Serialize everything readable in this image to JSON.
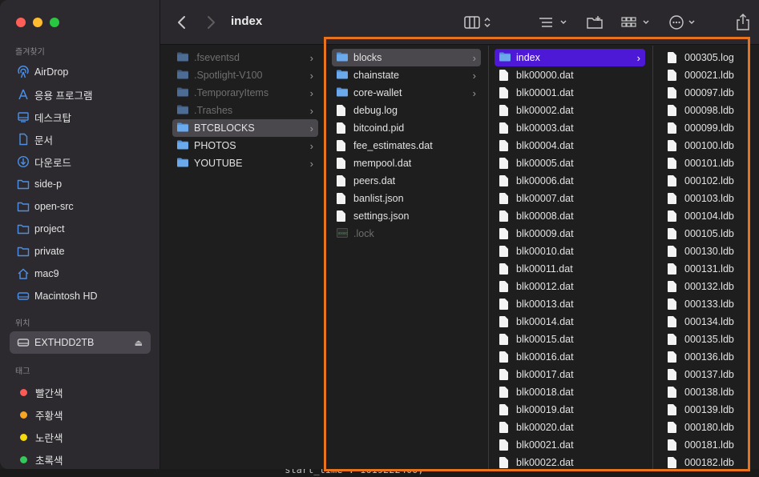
{
  "window": {
    "title": "index"
  },
  "sidebar": {
    "favorites_heading": "즐겨찾기",
    "favorites": [
      {
        "label": "AirDrop",
        "icon": "airdrop-icon"
      },
      {
        "label": "응용 프로그램",
        "icon": "applications-icon"
      },
      {
        "label": "데스크탑",
        "icon": "desktop-icon"
      },
      {
        "label": "문서",
        "icon": "document-icon"
      },
      {
        "label": "다운로드",
        "icon": "download-icon"
      },
      {
        "label": "side-p",
        "icon": "folder-icon"
      },
      {
        "label": "open-src",
        "icon": "folder-icon"
      },
      {
        "label": "project",
        "icon": "folder-icon"
      },
      {
        "label": "private",
        "icon": "folder-icon"
      },
      {
        "label": "mac9",
        "icon": "home-icon"
      },
      {
        "label": "Macintosh HD",
        "icon": "disk-icon"
      }
    ],
    "locations_heading": "위치",
    "locations": [
      {
        "label": "EXTHDD2TB",
        "icon": "external-disk-icon",
        "eject": "⏏"
      }
    ],
    "tags_heading": "태그",
    "tags": [
      {
        "label": "빨간색",
        "color": "#ff5a55"
      },
      {
        "label": "주황색",
        "color": "#f6a623"
      },
      {
        "label": "노란색",
        "color": "#f5d90a"
      },
      {
        "label": "초록색",
        "color": "#34c759"
      }
    ]
  },
  "columns": {
    "col1": [
      {
        "label": ".fseventsd",
        "type": "folder",
        "dim": true
      },
      {
        "label": ".Spotlight-V100",
        "type": "folder",
        "dim": true
      },
      {
        "label": ".TemporaryItems",
        "type": "folder",
        "dim": true
      },
      {
        "label": ".Trashes",
        "type": "folder",
        "dim": true
      },
      {
        "label": "BTCBLOCKS",
        "type": "folder",
        "selected": "gray"
      },
      {
        "label": "PHOTOS",
        "type": "folder"
      },
      {
        "label": "YOUTUBE",
        "type": "folder"
      }
    ],
    "col2": [
      {
        "label": "blocks",
        "type": "folder",
        "selected": "gray"
      },
      {
        "label": "chainstate",
        "type": "folder"
      },
      {
        "label": "core-wallet",
        "type": "folder"
      },
      {
        "label": "debug.log",
        "type": "doc"
      },
      {
        "label": "bitcoind.pid",
        "type": "doc"
      },
      {
        "label": "fee_estimates.dat",
        "type": "doc"
      },
      {
        "label": "mempool.dat",
        "type": "doc"
      },
      {
        "label": "peers.dat",
        "type": "doc"
      },
      {
        "label": "banlist.json",
        "type": "doc"
      },
      {
        "label": "settings.json",
        "type": "doc"
      },
      {
        "label": ".lock",
        "type": "exec",
        "dim": true
      }
    ],
    "col3": [
      {
        "label": "index",
        "type": "folder",
        "selected": "blue"
      },
      {
        "label": "blk00000.dat",
        "type": "doc"
      },
      {
        "label": "blk00001.dat",
        "type": "doc"
      },
      {
        "label": "blk00002.dat",
        "type": "doc"
      },
      {
        "label": "blk00003.dat",
        "type": "doc"
      },
      {
        "label": "blk00004.dat",
        "type": "doc"
      },
      {
        "label": "blk00005.dat",
        "type": "doc"
      },
      {
        "label": "blk00006.dat",
        "type": "doc"
      },
      {
        "label": "blk00007.dat",
        "type": "doc"
      },
      {
        "label": "blk00008.dat",
        "type": "doc"
      },
      {
        "label": "blk00009.dat",
        "type": "doc"
      },
      {
        "label": "blk00010.dat",
        "type": "doc"
      },
      {
        "label": "blk00011.dat",
        "type": "doc"
      },
      {
        "label": "blk00012.dat",
        "type": "doc"
      },
      {
        "label": "blk00013.dat",
        "type": "doc"
      },
      {
        "label": "blk00014.dat",
        "type": "doc"
      },
      {
        "label": "blk00015.dat",
        "type": "doc"
      },
      {
        "label": "blk00016.dat",
        "type": "doc"
      },
      {
        "label": "blk00017.dat",
        "type": "doc"
      },
      {
        "label": "blk00018.dat",
        "type": "doc"
      },
      {
        "label": "blk00019.dat",
        "type": "doc"
      },
      {
        "label": "blk00020.dat",
        "type": "doc"
      },
      {
        "label": "blk00021.dat",
        "type": "doc"
      },
      {
        "label": "blk00022.dat",
        "type": "doc"
      }
    ],
    "col4": [
      {
        "label": "000305.log",
        "type": "doc"
      },
      {
        "label": "000021.ldb",
        "type": "doc"
      },
      {
        "label": "000097.ldb",
        "type": "doc"
      },
      {
        "label": "000098.ldb",
        "type": "doc"
      },
      {
        "label": "000099.ldb",
        "type": "doc"
      },
      {
        "label": "000100.ldb",
        "type": "doc"
      },
      {
        "label": "000101.ldb",
        "type": "doc"
      },
      {
        "label": "000102.ldb",
        "type": "doc"
      },
      {
        "label": "000103.ldb",
        "type": "doc"
      },
      {
        "label": "000104.ldb",
        "type": "doc"
      },
      {
        "label": "000105.ldb",
        "type": "doc"
      },
      {
        "label": "000130.ldb",
        "type": "doc"
      },
      {
        "label": "000131.ldb",
        "type": "doc"
      },
      {
        "label": "000132.ldb",
        "type": "doc"
      },
      {
        "label": "000133.ldb",
        "type": "doc"
      },
      {
        "label": "000134.ldb",
        "type": "doc"
      },
      {
        "label": "000135.ldb",
        "type": "doc"
      },
      {
        "label": "000136.ldb",
        "type": "doc"
      },
      {
        "label": "000137.ldb",
        "type": "doc"
      },
      {
        "label": "000138.ldb",
        "type": "doc"
      },
      {
        "label": "000139.ldb",
        "type": "doc"
      },
      {
        "label": "000180.ldb",
        "type": "doc"
      },
      {
        "label": "000181.ldb",
        "type": "doc"
      },
      {
        "label": "000182.ldb",
        "type": "doc"
      }
    ]
  },
  "background_text": "\"start_time\": 1619222400,",
  "highlight_color": "#e8731f"
}
